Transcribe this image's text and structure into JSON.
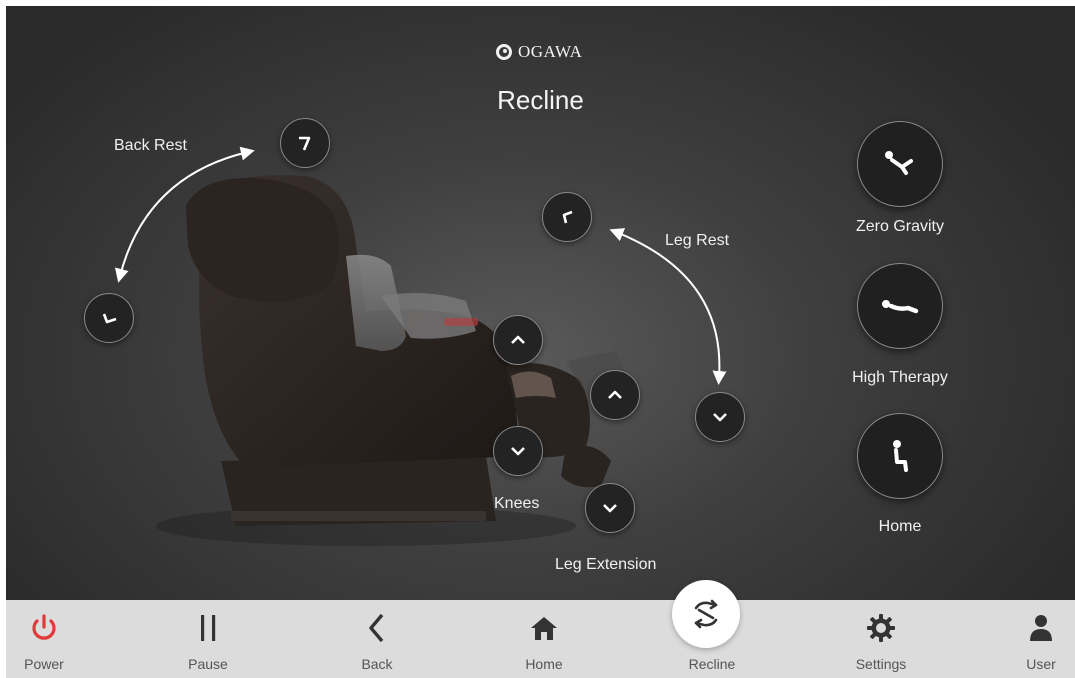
{
  "brand": {
    "logo_text": "OGAWA"
  },
  "page": {
    "title": "Recline"
  },
  "labels": {
    "back_rest": "Back Rest",
    "leg_rest": "Leg Rest",
    "knees": "Knees",
    "leg_extension": "Leg Extension"
  },
  "presets": [
    {
      "label": "Zero Gravity",
      "icon": "zero-gravity-icon"
    },
    {
      "label": "High Therapy",
      "icon": "high-therapy-icon"
    },
    {
      "label": "Home",
      "icon": "upright-home-icon"
    }
  ],
  "navbar": {
    "items": [
      {
        "label": "Power",
        "icon": "power-icon",
        "color": "#e03a3a"
      },
      {
        "label": "Pause",
        "icon": "pause-icon",
        "color": "#333333"
      },
      {
        "label": "Back",
        "icon": "back-chevron-icon",
        "color": "#333333"
      },
      {
        "label": "Home",
        "icon": "home-icon",
        "color": "#333333"
      },
      {
        "label": "Recline",
        "icon": "recline-icon",
        "color": "#333333",
        "active": true
      },
      {
        "label": "Settings",
        "icon": "gear-icon",
        "color": "#333333"
      },
      {
        "label": "User",
        "icon": "user-icon",
        "color": "#333333"
      }
    ]
  },
  "colors": {
    "background_dark": "#2a2a2a",
    "navbar_bg": "#dcdcdc",
    "power_red": "#e03a3a",
    "text_light": "#f0f0f0"
  }
}
